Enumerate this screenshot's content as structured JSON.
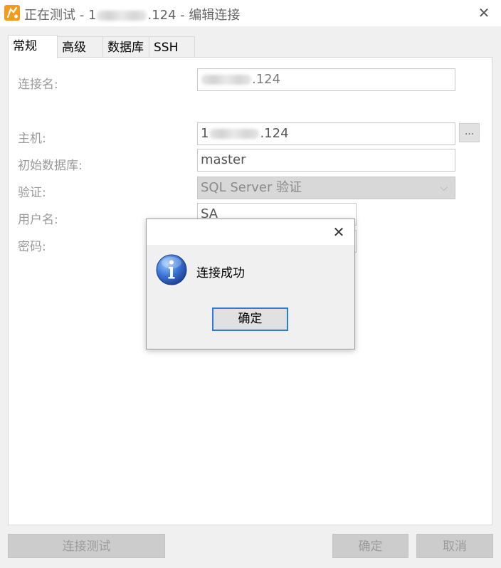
{
  "window": {
    "title_prefix": "正在测试 - 1",
    "title_suffix": ".124 - 编辑连接",
    "close_glyph": "✕",
    "icon": "navicat-app-icon"
  },
  "tabs": [
    {
      "label": "常规",
      "active": true
    },
    {
      "label": "高级",
      "active": false
    },
    {
      "label": "数据库",
      "active": false
    },
    {
      "label": "SSH",
      "active": false
    }
  ],
  "form": {
    "connection_name_label": "连接名:",
    "connection_name_value_suffix": ".124",
    "host_label": "主机:",
    "host_value_prefix": "1",
    "host_value_suffix": ".124",
    "host_browse_label": "...",
    "initial_db_label": "初始数据库:",
    "initial_db_value": "master",
    "auth_label": "验证:",
    "auth_value": "SQL Server 验证",
    "auth_chevron": "⌵",
    "username_label": "用户名:",
    "username_value": "SA",
    "password_label": "密码:"
  },
  "buttons": {
    "test_connection": "连接测试",
    "ok": "确定",
    "cancel": "取消"
  },
  "dialog": {
    "message": "连接成功",
    "ok_label": "确定",
    "close_glyph": "✕",
    "icon": "info-icon"
  },
  "colors": {
    "accent_border": "#2f7ad9",
    "app_icon": "#f29b1d",
    "info_icon": "#2a5cb8"
  }
}
